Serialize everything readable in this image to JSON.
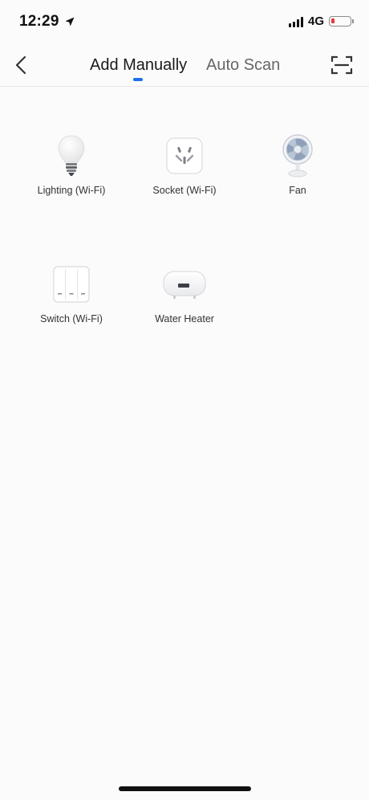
{
  "status_bar": {
    "time": "12:29",
    "network": "4G",
    "location_icon": "location-arrow-icon",
    "battery_color": "#e53935"
  },
  "nav": {
    "tabs": [
      {
        "label": "Add Manually",
        "active": true
      },
      {
        "label": "Auto Scan",
        "active": false
      }
    ],
    "back_icon": "chevron-left-icon",
    "scan_icon": "scan-frame-icon",
    "accent_color": "#1f6fea"
  },
  "devices": [
    {
      "label": "Lighting (Wi-Fi)",
      "icon": "light-bulb-icon"
    },
    {
      "label": "Socket (Wi-Fi)",
      "icon": "socket-icon"
    },
    {
      "label": "Fan",
      "icon": "fan-icon"
    },
    {
      "label": "Switch (Wi-Fi)",
      "icon": "wall-switch-icon"
    },
    {
      "label": "Water Heater",
      "icon": "water-heater-icon"
    }
  ]
}
